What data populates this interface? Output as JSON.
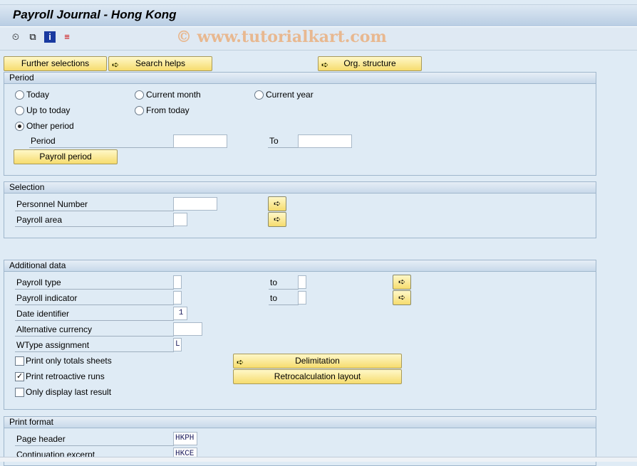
{
  "title": "Payroll Journal - Hong Kong",
  "watermark": "© www.tutorialkart.com",
  "toolbar": {
    "icons": [
      "execute-icon",
      "variant-icon",
      "info-icon",
      "selection-options-icon"
    ]
  },
  "buttons": {
    "further": "Further selections",
    "search": "Search helps",
    "org": "Org. structure"
  },
  "period": {
    "title": "Period",
    "today": "Today",
    "current_month": "Current month",
    "current_year": "Current year",
    "up_to_today": "Up to today",
    "from_today": "From today",
    "other_period": "Other period",
    "selected": "Other period",
    "period_label": "Period",
    "to_label": "To",
    "period_from": "",
    "period_to": "",
    "payroll_period_btn": "Payroll period"
  },
  "selection": {
    "title": "Selection",
    "personnel_number": "Personnel Number",
    "personnel_value": "",
    "payroll_area": "Payroll area",
    "payroll_area_value": ""
  },
  "additional": {
    "title": "Additional data",
    "payroll_type": "Payroll type",
    "payroll_indicator": "Payroll indicator",
    "to": "to",
    "date_identifier": "Date identifier",
    "date_identifier_value": "1",
    "alt_currency": "Alternative currency",
    "alt_currency_value": "",
    "wtype": "WType assignment",
    "wtype_value": "L",
    "print_totals": "Print only totals sheets",
    "print_totals_checked": false,
    "print_retro": "Print retroactive runs",
    "print_retro_checked": true,
    "last_result": "Only display last result",
    "last_result_checked": false,
    "delimitation": "Delimitation",
    "retro_layout": "Retrocalculation layout"
  },
  "print_format": {
    "title": "Print format",
    "page_header": "Page header",
    "page_header_value": "HKPH",
    "continuation": "Continuation excerpt",
    "continuation_value": "HKCE"
  }
}
